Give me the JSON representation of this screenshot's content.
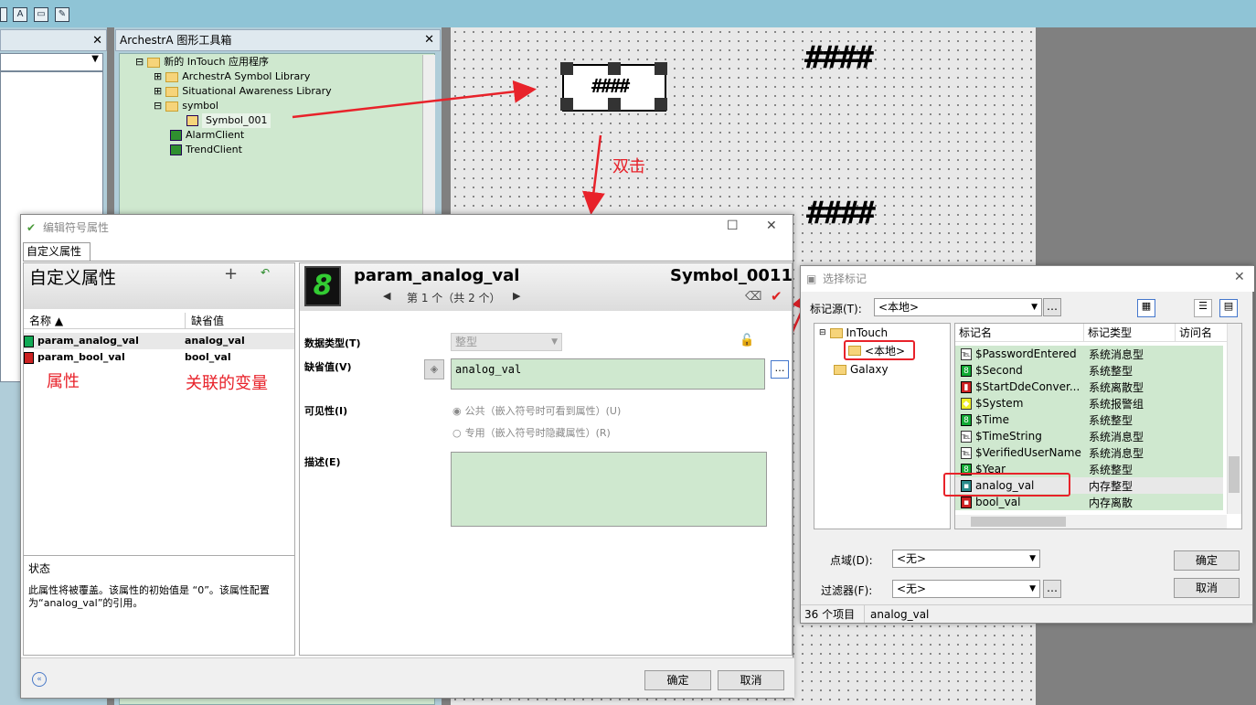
{
  "toolbox": {
    "title": "ArchestrA 图形工具箱",
    "tree": [
      "新的 InTouch 应用程序",
      "ArchestrA Symbol Library",
      "Situational Awareness Library",
      "symbol",
      "Symbol_001",
      "AlarmClient",
      "TrendClient"
    ]
  },
  "canvas": {
    "symbol_text": "####",
    "hash1": "####",
    "hash2": "####"
  },
  "annotations": {
    "double_click": "双击",
    "attribute": "属性",
    "variable": "关联的变量"
  },
  "edit_dialog": {
    "title": "编辑符号属性",
    "tab": "自定义属性",
    "list_title": "自定义属性",
    "col_name": "名称",
    "col_default": "缺省值",
    "rows": [
      {
        "name": "param_analog_val",
        "val": "analog_val"
      },
      {
        "name": "param_bool_val",
        "val": "bool_val"
      }
    ],
    "status_label": "状态",
    "status_text": "此属性将被覆盖。该属性的初始值是 “0”。该属性配置为“analog_val”的引用。",
    "param_name": "param_analog_val",
    "symbol_name": "Symbol_0011",
    "nav_text": "第 1 个（共 2 个）",
    "datatype_label": "数据类型(T)",
    "datatype_value": "整型",
    "default_label": "缺省值(V)",
    "default_value": "analog_val",
    "visibility_label": "可见性(I)",
    "public_label": "公共（嵌入符号时可看到属性）(U)",
    "private_label": "专用（嵌入符号时隐藏属性）(R)",
    "desc_label": "描述(E)",
    "ok": "确定",
    "cancel": "取消"
  },
  "select_dialog": {
    "title": "选择标记",
    "source_label": "标记源(T):",
    "source_value": "<本地>",
    "tree": {
      "root": "InTouch",
      "local": "<本地>",
      "galaxy": "Galaxy"
    },
    "col_name": "标记名",
    "col_type": "标记类型",
    "col_access": "访问名",
    "rows": [
      {
        "name": "$PasswordEntered",
        "type": "系统消息型",
        "icon": "msg"
      },
      {
        "name": "$Second",
        "type": "系统整型",
        "icon": "int"
      },
      {
        "name": "$StartDdeConver...",
        "type": "系统离散型",
        "icon": "disc"
      },
      {
        "name": "$System",
        "type": "系统报警组",
        "icon": "alarm"
      },
      {
        "name": "$Time",
        "type": "系统整型",
        "icon": "int"
      },
      {
        "name": "$TimeString",
        "type": "系统消息型",
        "icon": "msg"
      },
      {
        "name": "$VerifiedUserName",
        "type": "系统消息型",
        "icon": "msg"
      },
      {
        "name": "$Year",
        "type": "系统整型",
        "icon": "int"
      },
      {
        "name": "analog_val",
        "type": "内存整型",
        "icon": "mem"
      },
      {
        "name": "bool_val",
        "type": "内存离散",
        "icon": "memd"
      }
    ],
    "point_label": "点域(D):",
    "point_value": "<无>",
    "filter_label": "过滤器(F):",
    "filter_value": "<无>",
    "ok": "确定",
    "cancel": "取消",
    "count": "36 个项目",
    "selected": "analog_val"
  },
  "colors": {
    "accent": "#e8222a",
    "green": "#cfe8cf"
  }
}
